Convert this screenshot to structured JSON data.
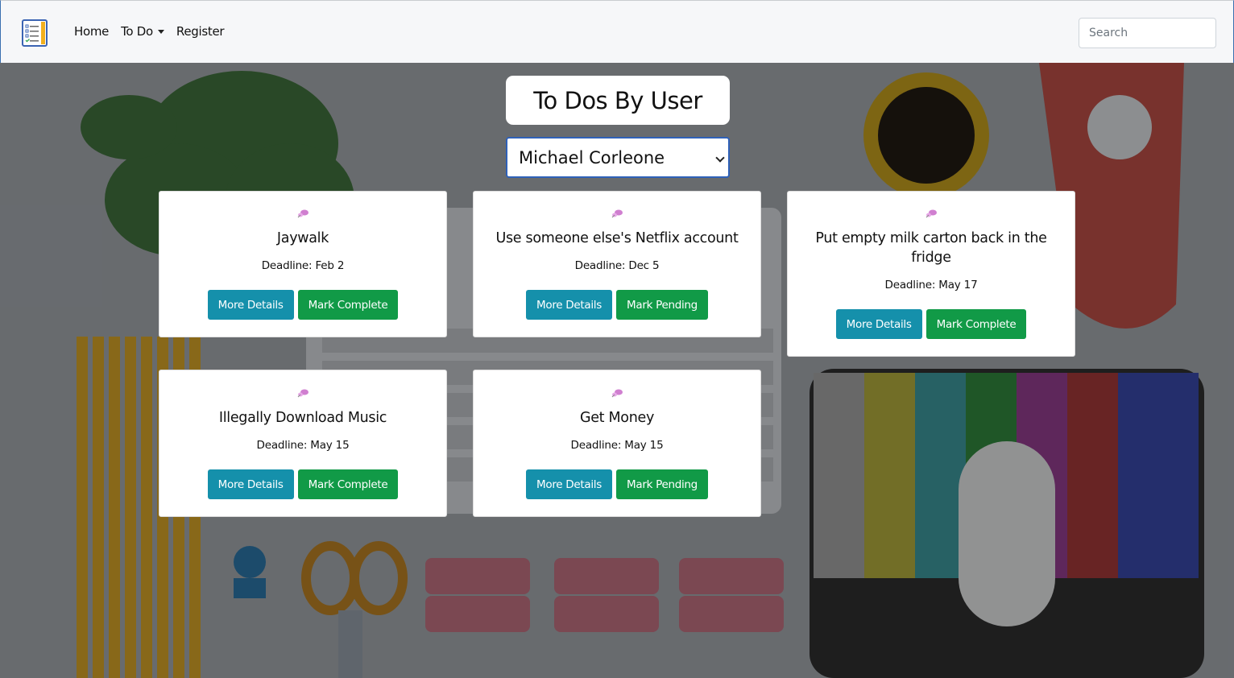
{
  "navbar": {
    "links": [
      "Home",
      "To Do",
      "Register"
    ],
    "search_placeholder": "Search"
  },
  "page": {
    "title": "To Dos By User",
    "selected_user": "Michael Corleone"
  },
  "todos": [
    {
      "title": "Jaywalk",
      "deadline": "Deadline: Feb 2",
      "details_label": "More Details",
      "action_label": "Mark Complete"
    },
    {
      "title": "Use someone else's Netflix account",
      "deadline": "Deadline: Dec 5",
      "details_label": "More Details",
      "action_label": "Mark Pending"
    },
    {
      "title": "Put empty milk carton back in the fridge",
      "deadline": "Deadline: May 17",
      "details_label": "More Details",
      "action_label": "Mark Complete"
    },
    {
      "title": "Illegally Download Music",
      "deadline": "Deadline: May 15",
      "details_label": "More Details",
      "action_label": "Mark Complete"
    },
    {
      "title": "Get Money",
      "deadline": "Deadline: May 15",
      "details_label": "More Details",
      "action_label": "Mark Pending"
    }
  ],
  "colors": {
    "info_button": "#1590ab",
    "success_button": "#119a47",
    "select_border": "#2f61b8"
  },
  "icons": {
    "logo": "checklist-icon",
    "card_pin": "pushpin-icon"
  }
}
